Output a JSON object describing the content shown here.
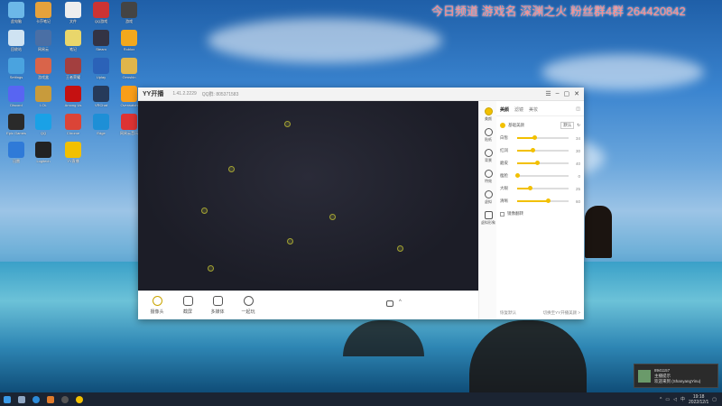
{
  "stream_overlay": "今日频道   游戏名 深渊之火 粉丝群4群 264420842",
  "desktop_icons": [
    {
      "label": "此电脑",
      "color": "#6cb8e8"
    },
    {
      "label": "卡莎笔记",
      "color": "#e6a23c"
    },
    {
      "label": "文件",
      "color": "#eeeeee"
    },
    {
      "label": "QQ游戏",
      "color": "#cc3333"
    },
    {
      "label": "游戏",
      "color": "#444444"
    },
    {
      "label": "回收站",
      "color": "#cfe3f2"
    },
    {
      "label": "网易云",
      "color": "#4a6fa5"
    },
    {
      "label": "笔记",
      "color": "#e9d66b"
    },
    {
      "label": "Steam",
      "color": "#333344"
    },
    {
      "label": "Roblox",
      "color": "#f2a81d"
    },
    {
      "label": "Settings",
      "color": "#4aa3df"
    },
    {
      "label": "游戏盒",
      "color": "#d9644a"
    },
    {
      "label": "王者荣耀",
      "color": "#a33f3f"
    },
    {
      "label": "Uplay",
      "color": "#2b62b8"
    },
    {
      "label": "Genshin",
      "color": "#e0b54a"
    },
    {
      "label": "Discord",
      "color": "#5865f2"
    },
    {
      "label": "LOL",
      "color": "#c89b3c"
    },
    {
      "label": "Among Us",
      "color": "#c51111"
    },
    {
      "label": "VRChat",
      "color": "#263a5a"
    },
    {
      "label": "Overwatch",
      "color": "#f99e1a"
    },
    {
      "label": "Epic Games",
      "color": "#2a2a2a"
    },
    {
      "label": "QQ",
      "color": "#1aa1e6"
    },
    {
      "label": "Chrome",
      "color": "#db4437"
    },
    {
      "label": "Edge",
      "color": "#1e8fd6"
    },
    {
      "label": "网易云音乐",
      "color": "#d33"
    },
    {
      "label": "迅雷",
      "color": "#2f7ad8"
    },
    {
      "label": "Logitech",
      "color": "#222222"
    },
    {
      "label": "YY直播",
      "color": "#f2c000"
    }
  ],
  "yy": {
    "title": "YY开播",
    "version": "1.41.2.2229",
    "qq_label": "QQ群: 805371583",
    "tools": [
      {
        "label": "摄像头"
      },
      {
        "label": "截屏"
      },
      {
        "label": "多媒体"
      },
      {
        "label": "一起玩"
      }
    ],
    "side_items": [
      {
        "label": "美颜"
      },
      {
        "label": "贴纸"
      },
      {
        "label": "背景"
      },
      {
        "label": "特效"
      },
      {
        "label": "虚拟"
      },
      {
        "label": "虚拟形象"
      }
    ],
    "panel": {
      "tabs": [
        "美颜",
        "滤镜",
        "美妆"
      ],
      "enable_label": "基础美颜",
      "mode": "默认",
      "rows": [
        {
          "name": "白皙",
          "value": "34",
          "level": 0.34
        },
        {
          "name": "红润",
          "value": "30",
          "level": 0.3
        },
        {
          "name": "磨皮",
          "value": "40",
          "level": 0.4
        },
        {
          "name": "瘦脸",
          "value": "0",
          "level": 0.0
        },
        {
          "name": "大眼",
          "value": "25",
          "level": 0.25
        },
        {
          "name": "清晰",
          "value": "60",
          "level": 0.6
        }
      ],
      "mirror_label": "镜像翻转",
      "footer_left": "恢复默认",
      "footer_right": "切换至YY开播美颜 >"
    }
  },
  "notification": {
    "title": "8941157",
    "line2": "主播提示",
    "line3": "欢迎来到 (ShanyangYinu)"
  },
  "taskbar": {
    "clock_time": "19:18",
    "clock_date": "2022/12/1",
    "tray_lang": "中"
  }
}
